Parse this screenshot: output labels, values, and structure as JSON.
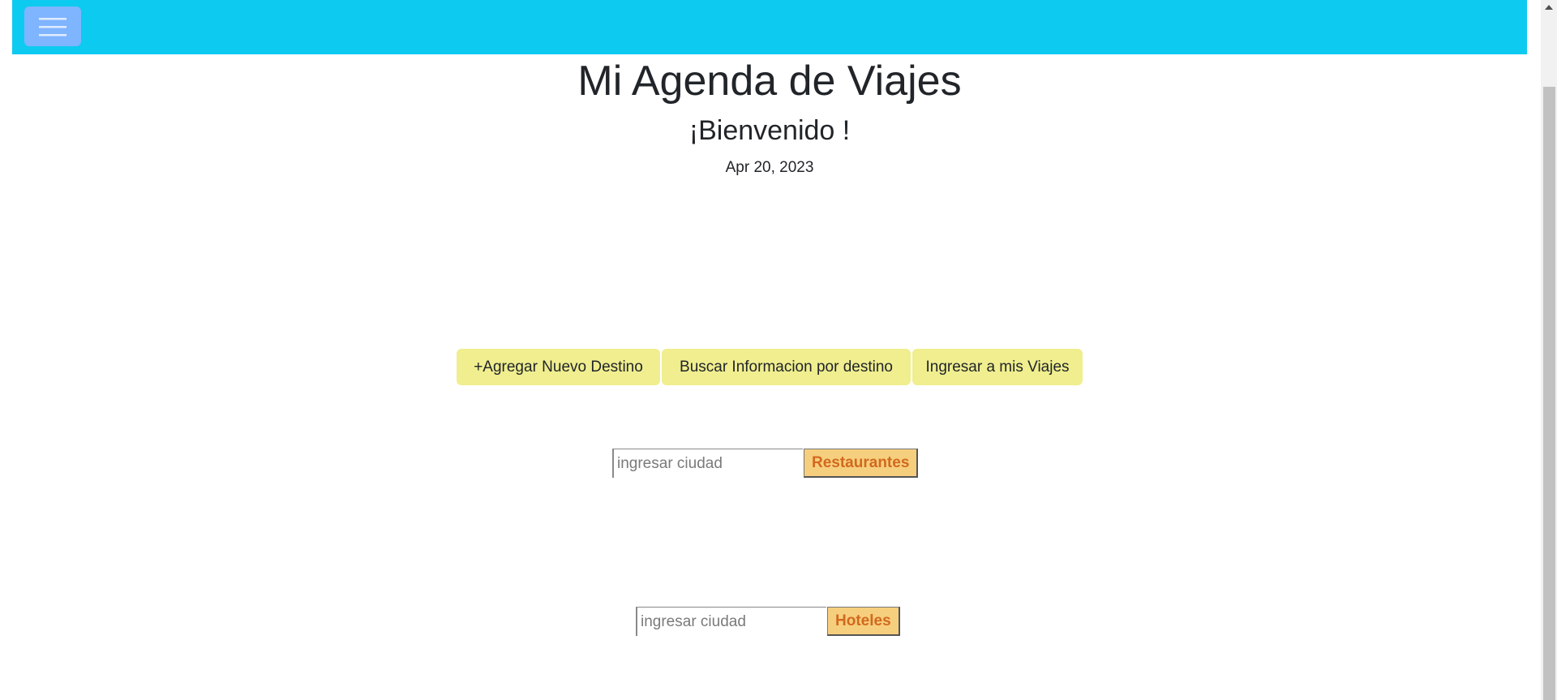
{
  "navbar": {
    "color": "#0dcaf0",
    "toggler_icon": "hamburger-menu-icon"
  },
  "header": {
    "title": "Mi Agenda de Viajes",
    "subtitle": "¡Bienvenido !",
    "date": "Apr 20, 2023"
  },
  "actions": {
    "buttons": [
      {
        "label": "+Agregar Nuevo Destino"
      },
      {
        "label": "Buscar Informacion por destino"
      },
      {
        "label": "Ingresar a mis Viajes"
      }
    ],
    "color": "#f0ee8f"
  },
  "restaurants": {
    "placeholder": "ingresar ciudad",
    "value": "",
    "button_label": "Restaurantes"
  },
  "hotels": {
    "placeholder": "ingresar ciudad",
    "value": "",
    "button_label": "Hoteles"
  },
  "colors": {
    "search_button_bg": "#f6cf7e",
    "search_button_text": "#d2691e"
  }
}
